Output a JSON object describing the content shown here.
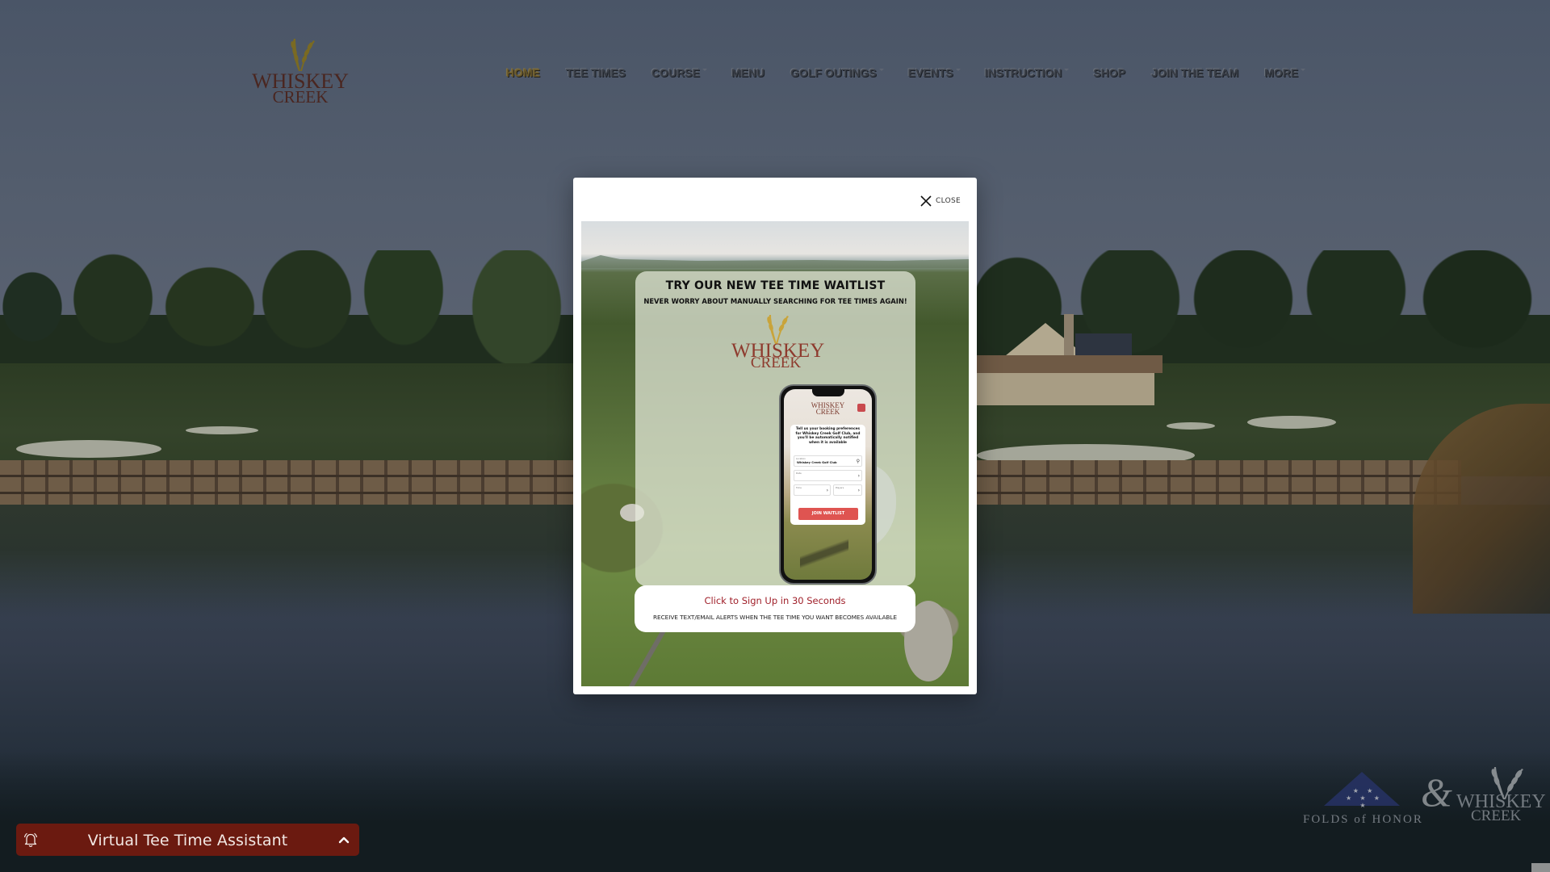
{
  "site": {
    "logo": {
      "line1": "WHISKEY",
      "line2": "CREEK",
      "alt": "Whiskey Creek logo"
    }
  },
  "nav": {
    "items": [
      {
        "label": "HOME",
        "active": true,
        "dropdown": false
      },
      {
        "label": "TEE TIMES",
        "active": false,
        "dropdown": false
      },
      {
        "label": "COURSE",
        "active": false,
        "dropdown": true
      },
      {
        "label": "MENU",
        "active": false,
        "dropdown": false
      },
      {
        "label": "GOLF OUTINGS",
        "active": false,
        "dropdown": true
      },
      {
        "label": "EVENTS",
        "active": false,
        "dropdown": true
      },
      {
        "label": "INSTRUCTION",
        "active": false,
        "dropdown": true
      },
      {
        "label": "SHOP",
        "active": false,
        "dropdown": false
      },
      {
        "label": "JOIN THE TEAM",
        "active": false,
        "dropdown": false
      },
      {
        "label": "MORE",
        "active": false,
        "dropdown": true
      }
    ]
  },
  "modal": {
    "close_label": "CLOSE",
    "promo": {
      "title": "TRY OUR NEW TEE TIME WAITLIST",
      "subtitle": "NEVER WORRY ABOUT MANUALLY SEARCHING FOR TEE TIMES AGAIN!",
      "logo_line1": "WHISKEY",
      "logo_line2": "CREEK",
      "phone": {
        "logo_line1": "WHISKEY",
        "logo_line2": "CREEK",
        "form_text": "Tell us your booking preferences for Whiskey Creek Golf Club, and you'll be automatically notified when it is available",
        "fields": [
          {
            "label": "Location",
            "value": "Whiskey Creek Golf Club"
          },
          {
            "label": "Date",
            "value": ""
          },
          {
            "label": "Time",
            "value": ""
          },
          {
            "label": "Players",
            "value": ""
          }
        ],
        "button_label": "JOIN WAITLIST"
      },
      "cta_title": "Click to Sign Up in 30 Seconds",
      "cta_subtitle": "RECEIVE TEXT/EMAIL ALERTS WHEN THE TEE TIME YOU WANT BECOMES AVAILABLE"
    }
  },
  "assistant_bar": {
    "label": "Virtual Tee Time Assistant",
    "icon": "bell-icon",
    "toggle_icon": "chevron-up-icon",
    "color": "#6b1a10"
  },
  "partner": {
    "folds": "FOLDS of HONOR",
    "ampersand": "&",
    "wc_line1": "WHISKEY",
    "wc_line2": "CREEK"
  },
  "colors": {
    "nav_active": "#6a5a2c",
    "cta_red": "#a0202a",
    "join_button": "#df5451",
    "logo_brown": "#4a2620"
  }
}
